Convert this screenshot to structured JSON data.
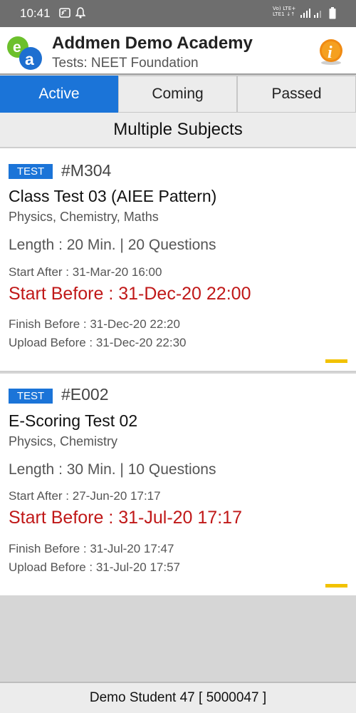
{
  "status_bar": {
    "time": "10:41",
    "network_label_top": "Vo) LTE+",
    "network_label_bottom": "LTE1 ↓↑"
  },
  "header": {
    "title": "Addmen Demo Academy",
    "subtitle": "Tests: NEET Foundation",
    "logo_icon": "ea-logo-icon",
    "info_icon": "info-icon"
  },
  "tabs": [
    {
      "label": "Active",
      "selected": true
    },
    {
      "label": "Coming",
      "selected": false
    },
    {
      "label": "Passed",
      "selected": false
    }
  ],
  "section": {
    "title": "Multiple Subjects"
  },
  "tests": [
    {
      "badge": "TEST",
      "id": "#M304",
      "name": "Class Test 03 (AIEE Pattern)",
      "subjects": "Physics, Chemistry, Maths",
      "length": "Length : 20 Min. | 20 Questions",
      "start_after": "Start After : 31-Mar-20 16:00",
      "start_before": "Start Before : 31-Dec-20 22:00",
      "finish_before": "Finish Before : 31-Dec-20 22:20",
      "upload_before": "Upload Before : 31-Dec-20 22:30"
    },
    {
      "badge": "TEST",
      "id": "#E002",
      "name": "E-Scoring Test 02",
      "subjects": "Physics, Chemistry",
      "length": "Length : 30 Min. | 10 Questions",
      "start_after": "Start After : 27-Jun-20 17:17",
      "start_before": "Start Before : 31-Jul-20 17:17",
      "finish_before": "Finish Before : 31-Jul-20 17:47",
      "upload_before": "Upload Before : 31-Jul-20 17:57"
    }
  ],
  "footer": {
    "student": "Demo Student 47 [ 5000047 ]"
  },
  "colors": {
    "accent": "#1b74d8",
    "deadline": "#c01818",
    "indicator": "#f2c200",
    "status_bar": "#6e6e6e"
  }
}
